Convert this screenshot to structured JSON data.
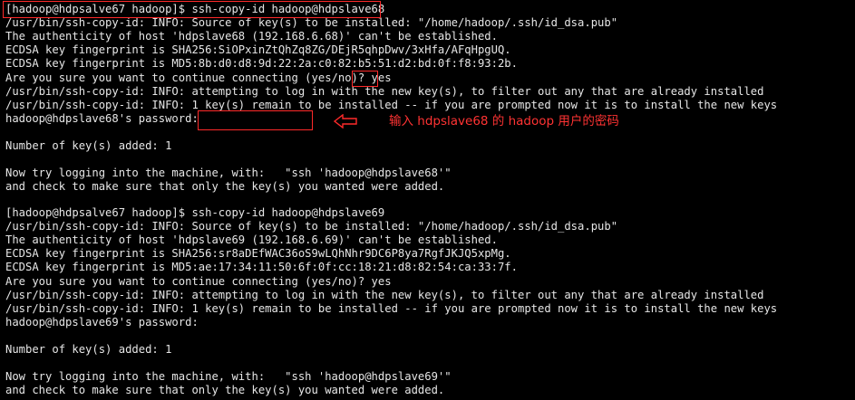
{
  "terminal": {
    "lines": [
      "[hadoop@hdpsalve67 hadoop]$ ssh-copy-id hadoop@hdpslave68",
      "/usr/bin/ssh-copy-id: INFO: Source of key(s) to be installed: \"/home/hadoop/.ssh/id_dsa.pub\"",
      "The authenticity of host 'hdpslave68 (192.168.6.68)' can't be established.",
      "ECDSA key fingerprint is SHA256:SiOPxinZtQhZq8ZG/DEjR5qhpDwv/3xHfa/AFqHpgUQ.",
      "ECDSA key fingerprint is MD5:8b:d0:d8:9d:22:2a:c0:82:b5:51:d2:bd:0f:f8:93:2b.",
      "Are you sure you want to continue connecting (yes/no)? yes",
      "/usr/bin/ssh-copy-id: INFO: attempting to log in with the new key(s), to filter out any that are already installed",
      "/usr/bin/ssh-copy-id: INFO: 1 key(s) remain to be installed -- if you are prompted now it is to install the new keys",
      "hadoop@hdpslave68's password:",
      "",
      "Number of key(s) added: 1",
      "",
      "Now try logging into the machine, with:   \"ssh 'hadoop@hdpslave68'\"",
      "and check to make sure that only the key(s) you wanted were added.",
      "",
      "[hadoop@hdpsalve67 hadoop]$ ssh-copy-id hadoop@hdpslave69",
      "/usr/bin/ssh-copy-id: INFO: Source of key(s) to be installed: \"/home/hadoop/.ssh/id_dsa.pub\"",
      "The authenticity of host 'hdpslave69 (192.168.6.69)' can't be established.",
      "ECDSA key fingerprint is SHA256:sr8aDEfWAC36oS9wLQhNhr9DC6P8ya7RgfJKJQ5xpMg.",
      "ECDSA key fingerprint is MD5:ae:17:34:11:50:6f:0f:cc:18:21:d8:82:54:ca:33:7f.",
      "Are you sure you want to continue connecting (yes/no)? yes",
      "/usr/bin/ssh-copy-id: INFO: attempting to log in with the new key(s), to filter out any that are already installed",
      "/usr/bin/ssh-copy-id: INFO: 1 key(s) remain to be installed -- if you are prompted now it is to install the new keys",
      "hadoop@hdpslave69's password:",
      "",
      "Number of key(s) added: 1",
      "",
      "Now try logging into the machine, with:   \"ssh 'hadoop@hdpslave69'\"",
      "and check to make sure that only the key(s) you wanted were added."
    ]
  },
  "annotation": {
    "text": "输入 hdpslave68 的 hadoop 用户的密码",
    "arrow_icon": "left-arrow-icon"
  },
  "colors": {
    "background": "#000000",
    "text": "#e6e6e6",
    "highlight": "#ff2a2a"
  }
}
